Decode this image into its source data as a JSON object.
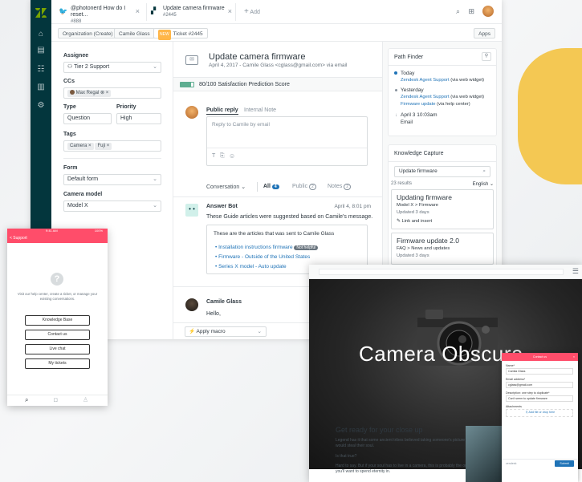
{
  "colors": {
    "nav": "#03363d",
    "accent": "#1f73b7",
    "brand_pink": "#ff4d6a",
    "satisfaction_green": "#5eae91"
  },
  "tabs": [
    {
      "title": "@photonerd How do I reset...",
      "sub": "#888"
    },
    {
      "title": "Update camera firmware",
      "sub": "#2445"
    },
    {
      "title": "Add"
    }
  ],
  "subbar": {
    "org": "Organization (Create)",
    "user": "Camile Glass",
    "new_badge": "NEW",
    "ticket": "Ticket #2445",
    "apps": "Apps"
  },
  "props": {
    "assignee_label": "Assignee",
    "assignee": "Tier 2 Support",
    "ccs_label": "CCs",
    "cc": "Max Regal",
    "type_label": "Type",
    "type": "Question",
    "priority_label": "Priority",
    "priority": "High",
    "tags_label": "Tags",
    "tags": [
      "Camera",
      "Fuji"
    ],
    "form_label": "Form",
    "form": "Default form",
    "model_label": "Camera model",
    "model": "Model X"
  },
  "ticket": {
    "title": "Update camera firmware",
    "meta": "April 4, 2017 - Camile Glass <cglass@gmail.com> via email",
    "satisfaction": "80/100 Satisfaction Prediction Score",
    "satisfaction_pct": 0.8,
    "tab_public": "Public reply",
    "tab_internal": "Internal Note",
    "reply_placeholder": "Reply to Camile by email",
    "conv_label": "Conversation",
    "all": "All",
    "all_count": "4",
    "public": "Public",
    "public_count": "2",
    "notes": "Notes",
    "notes_count": "2",
    "bot_name": "Answer Bot",
    "bot_date": "April 4, 8:01 pm",
    "bot_msg": "These Guide articles were suggested based on Camile's message.",
    "box_title": "These are the articles that was sent to Camile Glass",
    "articles": [
      "Installation instructions firmware",
      "Firmware - Outside of the United States",
      "Series X model - Auto update"
    ],
    "not_helpful": "Not helpful",
    "user_name": "Camile Glass",
    "user_msg": "Hello,",
    "macro": "Apply macro"
  },
  "pathfinder": {
    "title": "Path Finder",
    "today": "Today",
    "today_link": "Zendesk Agent Support",
    "today_via": "(via web widget)",
    "yesterday": "Yesterday",
    "y_link1": "Zendesk Agent Support",
    "y_via1": "(via web widget)",
    "y_link2": "Firmware update",
    "y_via2": "(via help center)",
    "date": "April 3 10:03am",
    "email": "Email"
  },
  "knowledge": {
    "title": "Knowledge Capture",
    "search": "Update firmware",
    "results": "23 results",
    "lang": "English",
    "r1_title": "Updating firmware",
    "r1_path": "Model X > Firmware",
    "r1_updated": "Updated 3 days",
    "link_insert": "Link and insert",
    "r2_title": "Firmware update 2.0",
    "r2_path": "FAQ > News and updates",
    "r2_updated": "Updated 3 days"
  },
  "mobile": {
    "status_left": "9:41 AM",
    "status_right": "100%",
    "header": "< Support",
    "msg": "Visit our help center, create a ticket, or manage your existing conversations.",
    "buttons": [
      "Knowledge Base",
      "Contact us",
      "Live chat",
      "My tickets"
    ]
  },
  "web": {
    "hero_title": "Camera Obscura",
    "heading": "Get ready for your close up",
    "p1": "Legend has it that some ancient tribes believed taking someone's picture would steal their soul.",
    "p2": "Is that true?",
    "p3": "Hard to say. But if your soul has to live in a camera, this is probably the one you'll want to spend eternity in.",
    "form_title": "Contact us",
    "name_label": "Name*",
    "name": "Camila Glass",
    "email_label": "Email address*",
    "email": "cglass@gmail.com",
    "steps_label": "Description: one step to duplicate*",
    "steps": "Can't seem to update firmware",
    "attach_label": "Attachments",
    "attach": "Add file or drop here",
    "submit": "Submit",
    "footer": "zendesk"
  }
}
